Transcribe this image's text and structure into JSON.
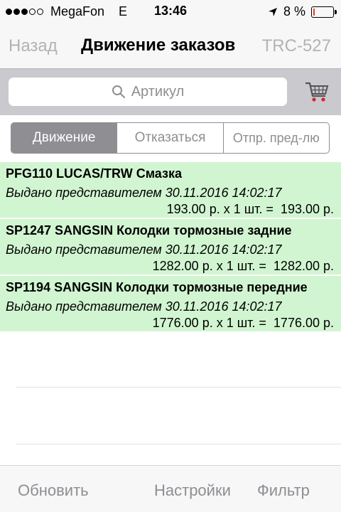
{
  "status_bar": {
    "signal_dots": [
      true,
      true,
      true,
      false,
      false
    ],
    "carrier": "MegaFon",
    "network": "E",
    "time": "13:46",
    "battery": "8 %",
    "battery_level": 0.08,
    "location_icon": "location-arrow-icon",
    "battery_color": "#e5352b"
  },
  "nav": {
    "back_label": "Назад",
    "title": "Движение заказов",
    "right_label": "TRC-527"
  },
  "search": {
    "placeholder": "Артикул",
    "icon": "search-icon",
    "cart_icon": "cart-icon"
  },
  "segments": [
    {
      "label": "Движение",
      "active": true
    },
    {
      "label": "Отказаться",
      "active": false
    },
    {
      "label": "Отпр. пред-лю",
      "active": false
    }
  ],
  "items": [
    {
      "title": "PFG110 LUCAS/TRW Смазка",
      "status": "Выдано представителем 30.11.2016 14:02:17",
      "price": "193.00 р. x 1 шт. =  193.00 р."
    },
    {
      "title": "SP1247 SANGSIN Колодки тормозные задние",
      "status": "Выдано представителем 30.11.2016 14:02:17",
      "price": "1282.00 р. x 1 шт. =  1282.00 р."
    },
    {
      "title": "SP1194 SANGSIN Колодки тормозные передние",
      "status": "Выдано представителем 30.11.2016 14:02:17",
      "price": "1776.00 р. x 1 шт. =  1776.00 р."
    }
  ],
  "toolbar": {
    "refresh_label": "Обновить",
    "settings_label": "Настройки",
    "filter_label": "Фильтр"
  },
  "colors": {
    "row_background": "#d1f5d1",
    "segment_active": "#8e8e93",
    "cart_accent": "#d0262d"
  }
}
